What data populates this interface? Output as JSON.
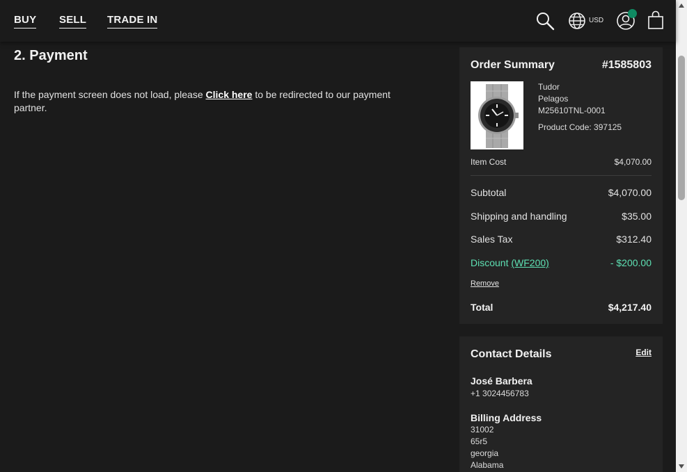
{
  "nav": {
    "buy": "BUY",
    "sell": "SELL",
    "trade_in": "TRADE IN"
  },
  "header": {
    "currency": "USD",
    "icons": [
      "search-icon",
      "globe-icon",
      "account-icon",
      "shopping-bag-icon"
    ],
    "notification_color": "#0f8a62"
  },
  "payment": {
    "title": "2. Payment",
    "text_before": "If the payment screen does not load, please ",
    "link": "Click here",
    "text_after": " to be redirected to our payment partner."
  },
  "summary": {
    "title": "Order Summary",
    "order_number": "#1585803",
    "product": {
      "brand": "Tudor",
      "model": "Pelagos",
      "reference": "M25610TNL-0001",
      "code": "Product Code: 397125"
    },
    "item_cost_label": "Item Cost",
    "item_cost": "$4,070.00",
    "subtotal_label": "Subtotal",
    "subtotal": "$4,070.00",
    "shipping_label": "Shipping and handling",
    "shipping": "$35.00",
    "tax_label": "Sales Tax",
    "tax": "$312.40",
    "discount_label": "Discount ",
    "discount_code": "(WF200)",
    "discount": "- $200.00",
    "remove": "Remove",
    "total_label": "Total",
    "total": "$4,217.40",
    "discount_color": "#5ee0b3"
  },
  "contact": {
    "title": "Contact Details",
    "edit": "Edit",
    "name": "José Barbera",
    "phone": "+1 3024456783",
    "billing_title": "Billing Address",
    "billing_lines": [
      "31002",
      "65r5",
      "georgia",
      "Alabama"
    ]
  }
}
